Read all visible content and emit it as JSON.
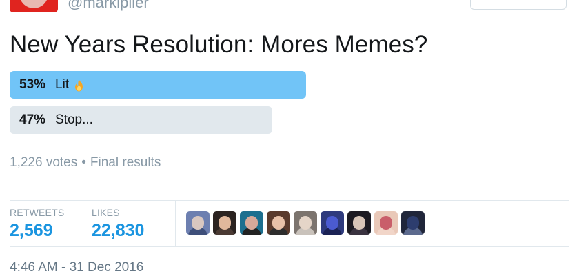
{
  "author": {
    "handle": "@markiplier"
  },
  "poll": {
    "question": "New Years Resolution: Mores Memes?",
    "options": [
      {
        "percent": "53%",
        "label": "Lit",
        "share": 0.53,
        "icon": "fire-icon",
        "color": "#71c4f7"
      },
      {
        "percent": "47%",
        "label": "Stop...",
        "share": 0.47,
        "color": "#e1e8ed"
      }
    ],
    "votes": "1,226 votes",
    "separator": "•",
    "status": "Final results"
  },
  "stats": {
    "retweets_label": "RETWEETS",
    "retweets_value": "2,569",
    "likes_label": "LIKES",
    "likes_value": "22,830",
    "value_color": "#1b95e0"
  },
  "likers": [
    {
      "name": "liker-avatar-1",
      "bg": "#6d7fb0",
      "head": "#d9c7c0",
      "body": "#3e4f7a"
    },
    {
      "name": "liker-avatar-2",
      "bg": "#2b2320",
      "head": "#e1b89c",
      "body": "#4a3a33"
    },
    {
      "name": "liker-avatar-3",
      "bg": "#1d6f8f",
      "head": "#d8a99a",
      "body": "#222222"
    },
    {
      "name": "liker-avatar-4",
      "bg": "#5a3a2c",
      "head": "#e8c1a8",
      "body": "#2d2d2d"
    },
    {
      "name": "liker-avatar-5",
      "bg": "#7c746e",
      "head": "#e5d5c8",
      "body": "#c9c2bb"
    },
    {
      "name": "liker-avatar-6",
      "bg": "#2e3a7d",
      "head": "#4b5bd1",
      "body": "#1b2255"
    },
    {
      "name": "liker-avatar-7",
      "bg": "#1c1a22",
      "head": "#d8c5b8",
      "body": "#3a3340"
    },
    {
      "name": "liker-avatar-8",
      "bg": "#e9c8b8",
      "head": "#c95e6a",
      "body": "#f1d5c8"
    },
    {
      "name": "liker-avatar-9",
      "bg": "#20263a",
      "head": "#2d3d6e",
      "body": "#5c6a8e"
    }
  ],
  "timestamp": "4:46 AM - 31 Dec 2016"
}
